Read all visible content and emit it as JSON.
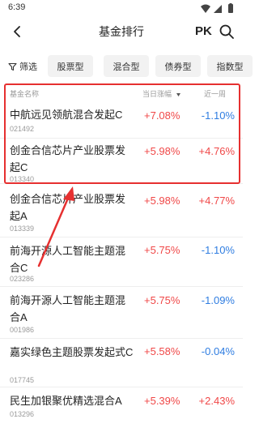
{
  "status_bar": {
    "time": "6:39"
  },
  "header": {
    "title": "基金排行",
    "pk_label": "PK"
  },
  "filters": {
    "filter_label": "筛选",
    "tabs": [
      "股票型",
      "混合型",
      "债券型",
      "指数型"
    ]
  },
  "table": {
    "columns": {
      "name": "基金名称",
      "day_change": "当日涨幅",
      "week_change": "近一周"
    },
    "rows": [
      {
        "name": "中航远见领航混合发起C",
        "code": "021492",
        "day_change": "+7.08%",
        "week_change": "-1.10%"
      },
      {
        "name": "创金合信芯片产业股票发起C",
        "code": "013340",
        "day_change": "+5.98%",
        "week_change": "+4.76%"
      },
      {
        "name": "创金合信芯片产业股票发起A",
        "code": "013339",
        "day_change": "+5.98%",
        "week_change": "+4.77%"
      },
      {
        "name": "前海开源人工智能主题混合C",
        "code": "023286",
        "day_change": "+5.75%",
        "week_change": "-1.10%"
      },
      {
        "name": "前海开源人工智能主题混合A",
        "code": "001986",
        "day_change": "+5.75%",
        "week_change": "-1.09%"
      },
      {
        "name": "嘉实绿色主题股票发起式C",
        "code": "017745",
        "day_change": "+5.58%",
        "week_change": "-0.04%"
      },
      {
        "name": "民生加银聚优精选混合A",
        "code": "013296",
        "day_change": "+5.39%",
        "week_change": "+2.43%"
      }
    ]
  },
  "colors": {
    "up": "#f04848",
    "down": "#2f7de1",
    "highlight": "#e63030"
  }
}
